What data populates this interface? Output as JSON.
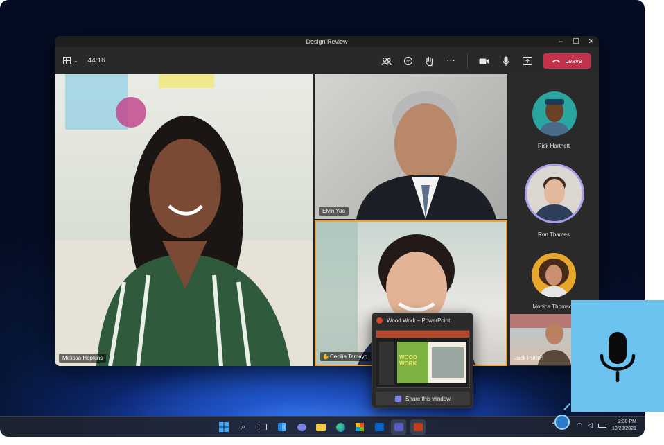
{
  "window": {
    "title": "Design Review"
  },
  "toolbar": {
    "timer": "44:16",
    "leave_label": "Leave"
  },
  "participants": {
    "melissa": "Melissa Hopkins",
    "elvin": "Elvin Yoo",
    "cecilia": "Cecilia Tamayo",
    "rick": "Rick Hartnett",
    "ron": "Ron Thames",
    "monica": "Monica Thomson",
    "jack": "Jack Purton"
  },
  "share_popup": {
    "title": "Wood Work – PowerPoint",
    "slide_text": "WOOD WORK",
    "share_label": "Share this window"
  },
  "taskbar": {
    "time": "2:30 PM",
    "date": "10/20/2021"
  },
  "colors": {
    "leave": "#c4314b",
    "active_speaker": "#f0a13a",
    "mic_card": "#6cc3f0"
  }
}
